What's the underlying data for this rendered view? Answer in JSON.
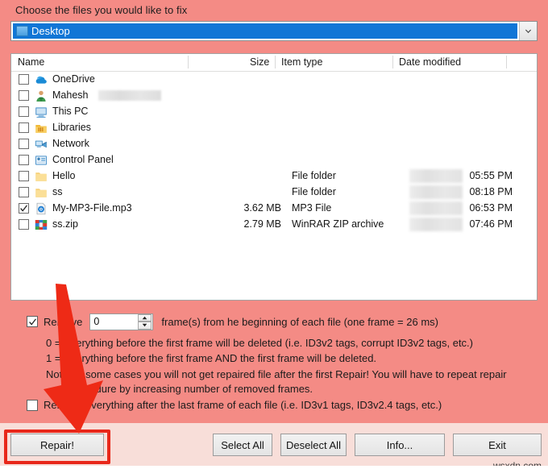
{
  "header": {
    "prompt": "Choose the files you would like to fix"
  },
  "path_combo": {
    "value": "Desktop",
    "icon": "folder-icon",
    "dropdown_icon": "chevron-down-icon"
  },
  "file_list": {
    "columns": [
      "Name",
      "Size",
      "Item type",
      "Date modified"
    ],
    "rows": [
      {
        "checked": false,
        "icon": "onedrive-icon",
        "name": "OneDrive",
        "redacted_name": false,
        "size": "",
        "type": "",
        "date": ""
      },
      {
        "checked": false,
        "icon": "user-icon",
        "name": "Mahesh",
        "redacted_name": true,
        "size": "",
        "type": "",
        "date": ""
      },
      {
        "checked": false,
        "icon": "this-pc-icon",
        "name": "This PC",
        "redacted_name": false,
        "size": "",
        "type": "",
        "date": ""
      },
      {
        "checked": false,
        "icon": "libraries-icon",
        "name": "Libraries",
        "redacted_name": false,
        "size": "",
        "type": "",
        "date": ""
      },
      {
        "checked": false,
        "icon": "network-icon",
        "name": "Network",
        "redacted_name": false,
        "size": "",
        "type": "",
        "date": ""
      },
      {
        "checked": false,
        "icon": "control-panel-icon",
        "name": "Control Panel",
        "redacted_name": false,
        "size": "",
        "type": "",
        "date": ""
      },
      {
        "checked": false,
        "icon": "folder-icon",
        "name": "Hello",
        "redacted_name": false,
        "size": "",
        "type": "File folder",
        "date": "05:55 PM"
      },
      {
        "checked": false,
        "icon": "folder-icon",
        "name": "ss",
        "redacted_name": false,
        "size": "",
        "type": "File folder",
        "date": "08:18 PM"
      },
      {
        "checked": true,
        "icon": "mp3-file-icon",
        "name": "My-MP3-File.mp3",
        "redacted_name": false,
        "size": "3.62 MB",
        "type": "MP3 File",
        "date": "06:53 PM"
      },
      {
        "checked": false,
        "icon": "winrar-zip-icon",
        "name": "ss.zip",
        "redacted_name": false,
        "size": "2.79 MB",
        "type": "WinRAR ZIP archive",
        "date": "07:46 PM"
      }
    ]
  },
  "options": {
    "remove_checked": true,
    "remove_label": "Remove",
    "frames_value": "0",
    "remove_suffix": "frame(s) from he beginning of each file (one frame = 26 ms)",
    "info_lines": [
      "0 = Everything before the first frame will be deleted (i.e. ID3v2 tags, corrupt ID3v2 tags, etc.)",
      "1 = Everything before the first frame AND the first frame will be deleted.",
      "Note: In some cases you will not get repaired file after the first Repair! You will have to repeat repair",
      "procedure by increasing number of removed frames."
    ],
    "last_checked": false,
    "last_label": "Remove everything after the last frame of each file (i.e. ID3v1 tags, ID3v2.4 tags, etc.)"
  },
  "footer": {
    "repair": "Repair!",
    "select_all": "Select All",
    "deselect_all": "Deselect All",
    "info": "Info...",
    "exit": "Exit"
  },
  "watermark": "wsxdn.com",
  "annotation": {
    "arrow_color": "#ee2a16",
    "highlight_color": "#e8271a",
    "target": "repair-button"
  },
  "colors": {
    "background": "#f48b85",
    "selection_blue": "#1176d6",
    "footer_bg": "#f8ded9"
  }
}
